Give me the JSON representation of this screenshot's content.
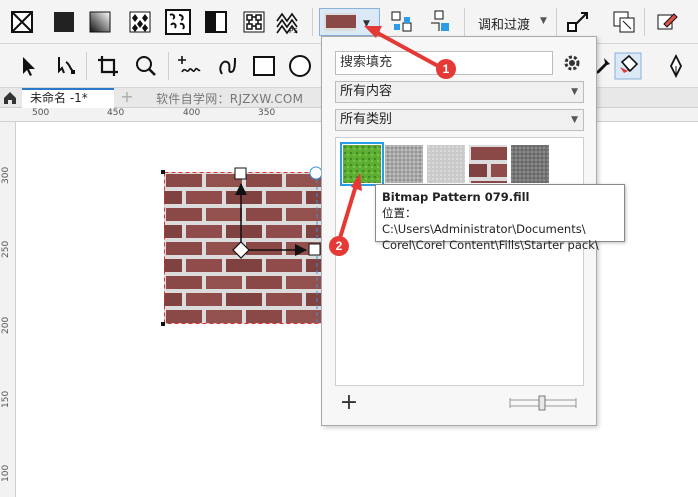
{
  "toolbar_top": {
    "tools": [
      "no-fill-icon",
      "uniform-fill-icon",
      "fountain-fill-icon",
      "vector-pattern-fill-icon",
      "bitmap-pattern-fill-icon",
      "two-color-pattern-fill-icon",
      "texture-fill-icon",
      "postscript-fill-icon"
    ],
    "blend_label": "调和过渡"
  },
  "tabs": {
    "document": "未命名 -1*",
    "watermark": "软件自学网：RJZXW.COM"
  },
  "ruler": {
    "h_labels": [
      "500",
      "450",
      "400",
      "350"
    ],
    "v_labels": [
      "300",
      "250",
      "200",
      "150",
      "100"
    ]
  },
  "panel": {
    "search_placeholder": "搜索填充",
    "content_filter": "所有内容",
    "category_filter": "所有类别",
    "thumbnails": [
      "green-grass",
      "gray-noise",
      "light-gray",
      "brown-brick",
      "dark-gray"
    ]
  },
  "tooltip": {
    "title": "Bitmap Pattern 079.fill",
    "location_line1": "位置：  C:\\Users\\Administrator\\Documents\\",
    "location_line2": "Corel\\Corel Content\\Fills\\Starter pack\\"
  },
  "annotations": {
    "badge1": "1",
    "badge2": "2"
  },
  "colors": {
    "accent": "#2b79c9",
    "annotation": "#e53935",
    "brick": "#8d4a48"
  }
}
